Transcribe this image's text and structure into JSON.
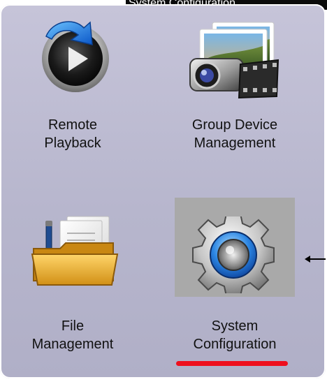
{
  "window": {
    "top_banner_text": "System Configuration"
  },
  "tiles": [
    {
      "label_line1": "Remote",
      "label_line2": "Playback",
      "icon": "remote-playback-icon"
    },
    {
      "label_line1": "Group Device",
      "label_line2": "Management",
      "icon": "camcorder-photos-icon"
    },
    {
      "label_line1": "File",
      "label_line2": "Management",
      "icon": "folder-documents-icon"
    },
    {
      "label_line1": "System",
      "label_line2": "Configuration",
      "icon": "gear-icon"
    }
  ],
  "selection": {
    "selected_tile": "System Configuration",
    "underline_color": "#ee0f1d"
  },
  "colors": {
    "panel_top": "#c6c4d9",
    "panel_bottom": "#b0afc7",
    "selected_tile_bg": "#a9a9a9"
  }
}
